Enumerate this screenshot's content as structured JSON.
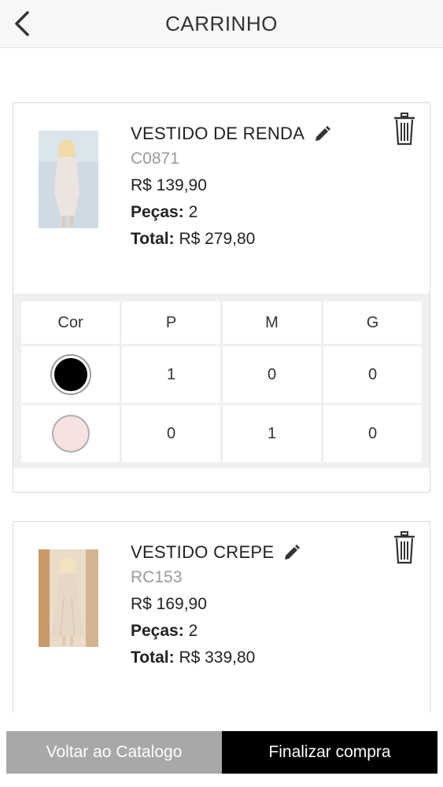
{
  "header": {
    "title": "CARRINHO"
  },
  "products": [
    {
      "name": "VESTIDO DE RENDA",
      "code": "C0871",
      "price": "R$ 139,90",
      "pieces_label": "Peças:",
      "pieces_value": "2",
      "total_label": "Total:",
      "total_value": "R$ 279,80",
      "grid": {
        "headers": [
          "Cor",
          "P",
          "M",
          "G"
        ],
        "rows": [
          {
            "color": "#000000",
            "values": [
              "1",
              "0",
              "0"
            ]
          },
          {
            "color": "#f7e1e1",
            "values": [
              "0",
              "1",
              "0"
            ]
          }
        ]
      }
    },
    {
      "name": "VESTIDO CREPE",
      "code": "RC153",
      "price": "R$ 169,90",
      "pieces_label": "Peças:",
      "pieces_value": "2",
      "total_label": "Total:",
      "total_value": "R$ 339,80"
    }
  ],
  "footer": {
    "back_label": "Voltar ao Catalogo",
    "finish_label": "Finalizar compra"
  },
  "icons": {
    "back": "chevron-left-icon",
    "edit": "pencil-icon",
    "delete": "trash-icon"
  }
}
